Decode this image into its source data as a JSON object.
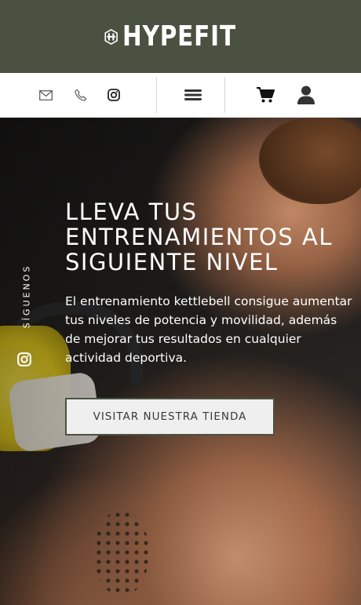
{
  "brand": {
    "name": "HYPEFIT"
  },
  "nav": {
    "icons": [
      "mail-icon",
      "phone-icon",
      "instagram-icon",
      "menu-icon",
      "cart-icon",
      "user-icon"
    ]
  },
  "hero": {
    "title": "LLEVA TUS ENTRENAMIENTOS AL SIGUIENTE NIVEL",
    "text": "El entrenamiento kettlebell consigue aumentar tus niveles de potencia y movilidad, además de mejorar tus resultados en cualquier actividad deportiva.",
    "cta_label": "VISITAR NUESTRA TIENDA"
  },
  "social": {
    "label": "SÍGUENOS"
  },
  "colors": {
    "header_bg": "#4b5141",
    "nav_bg": "#ffffff",
    "button_bg": "#efefef",
    "text": "#ffffff"
  }
}
